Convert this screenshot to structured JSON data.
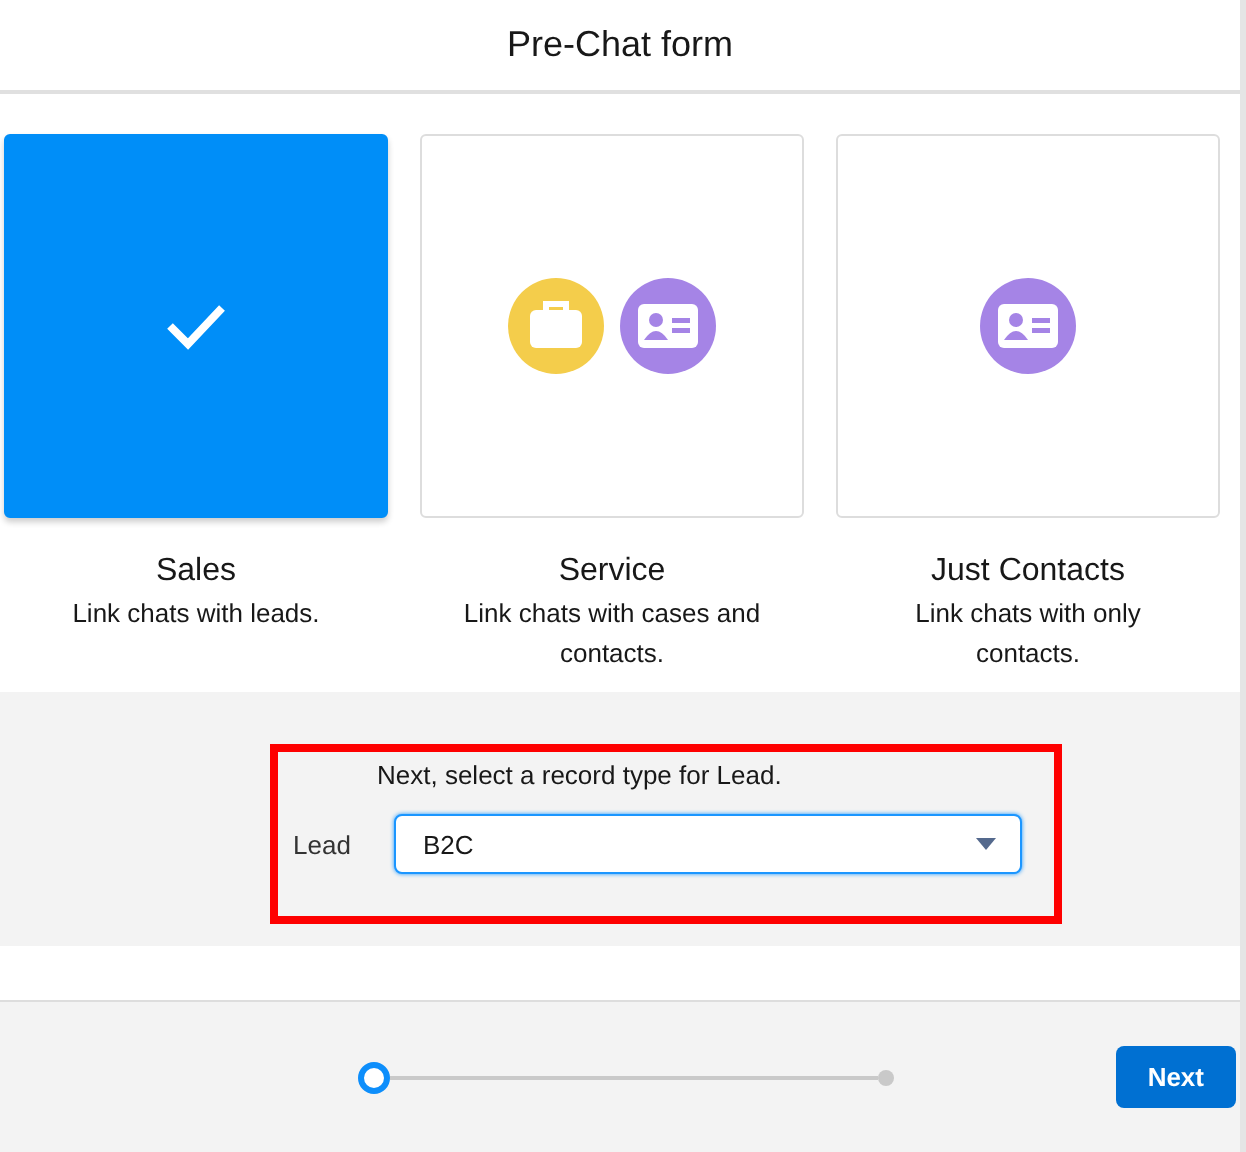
{
  "title": "Pre-Chat form",
  "options": [
    {
      "name": "Sales",
      "description": "Link chats with leads.",
      "selected": true
    },
    {
      "name": "Service",
      "description": "Link chats with cases and contacts.",
      "selected": false,
      "icons": [
        {
          "kind": "briefcase"
        },
        {
          "kind": "card"
        }
      ]
    },
    {
      "name": "Just Contacts",
      "description": "Link chats with only contacts.",
      "selected": false,
      "icons": [
        {
          "kind": "card"
        }
      ]
    }
  ],
  "record_type": {
    "prompt": "Next, select a record type for Lead.",
    "label": "Lead",
    "value": "B2C",
    "highlighted": true
  },
  "steps": [
    {
      "selected": true
    },
    {
      "selected": false
    }
  ],
  "buttons": [
    "Next"
  ]
}
